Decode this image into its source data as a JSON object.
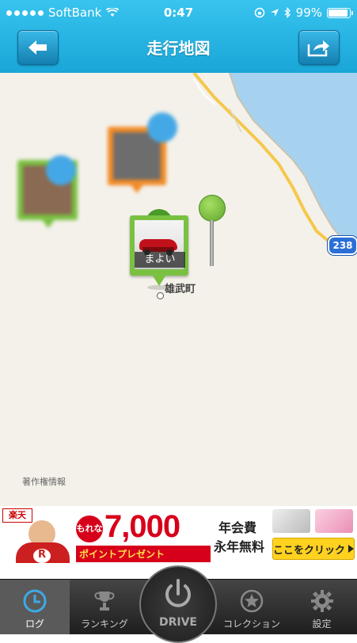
{
  "status_bar": {
    "carrier": "SoftBank",
    "time": "0:47",
    "battery": "99%"
  },
  "header": {
    "title": "走行地図",
    "back_icon": "arrow-left-icon",
    "share_icon": "share-arrow-icon"
  },
  "map": {
    "place_label": "雄武町",
    "copyright": "著作権情報",
    "route_number": "238",
    "pins": [
      {
        "caption": "まよい",
        "color": "#7ac142"
      }
    ],
    "colors": {
      "land": "#f4f1ea",
      "sea": "#a7d2ef",
      "road": "#f5c84c",
      "pin_green": "#7ac142",
      "pin_orange": "#f28c28",
      "blue_marker": "#45a8e6"
    }
  },
  "ad": {
    "store": "楽天",
    "headline": "もれなく",
    "points": "7,000",
    "points_suffix": "ポイントプレゼント",
    "fee_line1": "年会費",
    "fee_line2": "永年無料",
    "cta": "ここをクリック"
  },
  "tabs": [
    {
      "label": "ログ",
      "icon": "clock-icon"
    },
    {
      "label": "ランキング",
      "icon": "trophy-icon"
    },
    {
      "label": "DRIVE",
      "icon": "power-icon"
    },
    {
      "label": "コレクション",
      "icon": "star-icon"
    },
    {
      "label": "設定",
      "icon": "gear-icon"
    }
  ]
}
